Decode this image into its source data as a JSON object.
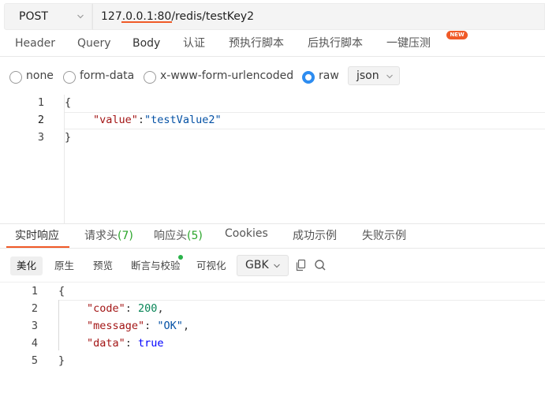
{
  "request": {
    "method": "POST",
    "url": "127.0.0.1:80/redis/testKey2"
  },
  "request_tabs": [
    {
      "label": "Header"
    },
    {
      "label": "Query"
    },
    {
      "label": "Body"
    },
    {
      "label": "认证"
    },
    {
      "label": "预执行脚本"
    },
    {
      "label": "后执行脚本"
    },
    {
      "label": "一键压测"
    }
  ],
  "active_request_tab": "Body",
  "new_badge": "NEW",
  "body_types": [
    {
      "label": "none",
      "checked": false
    },
    {
      "label": "form-data",
      "checked": false
    },
    {
      "label": "x-www-form-urlencoded",
      "checked": false
    },
    {
      "label": "raw",
      "checked": true
    }
  ],
  "raw_format": "json",
  "request_body": {
    "line_numbers": [
      "1",
      "2",
      "3"
    ],
    "lines": {
      "l1": "{",
      "l2_key": "\"value\"",
      "l2_sep": ":",
      "l2_val": "\"testValue2\"",
      "l3": "}"
    }
  },
  "response_tabs": [
    {
      "label": "实时响应",
      "count": ""
    },
    {
      "label": "请求头",
      "count": "(7)"
    },
    {
      "label": "响应头",
      "count": "(5)"
    },
    {
      "label": "Cookies",
      "count": ""
    },
    {
      "label": "成功示例",
      "count": ""
    },
    {
      "label": "失败示例",
      "count": ""
    }
  ],
  "active_response_tab": "实时响应",
  "response_toolbar": {
    "items": [
      "美化",
      "原生",
      "预览",
      "断言与校验",
      "可视化"
    ],
    "active": "美化",
    "encoding": "GBK"
  },
  "response_body": {
    "line_numbers": [
      "1",
      "2",
      "3",
      "4",
      "5"
    ],
    "lines": {
      "l1": "{",
      "l2_key": "\"code\"",
      "l2_val": "200",
      "l3_key": "\"message\"",
      "l3_val": "\"OK\"",
      "l4_key": "\"data\"",
      "l4_val": "true",
      "l5": "}"
    }
  },
  "colors": {
    "accent": "#f05a28",
    "radio_checked": "#2d8cf0",
    "count_green": "#2aa52a",
    "status_dot": "#2ab24a"
  },
  "icons": {
    "method_dropdown": "chevron-down-icon",
    "format_dropdown": "chevron-down-icon",
    "copy": "copy-icon",
    "search": "search-icon"
  }
}
